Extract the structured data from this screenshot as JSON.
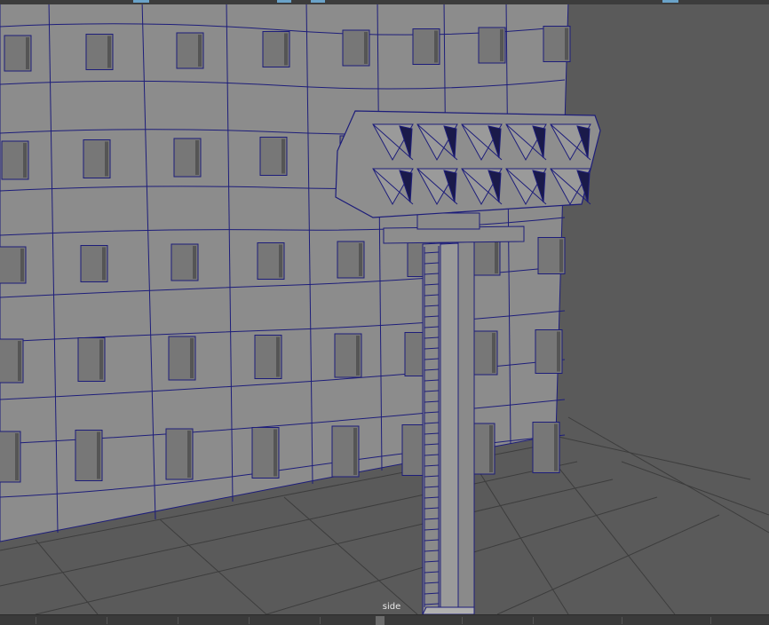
{
  "viewport": {
    "camera_label": "side"
  },
  "colors": {
    "background": "#5a5a5a",
    "wireframe": "#1d1d7a",
    "building_face": "#8c8c8c",
    "window_recess": "#6a6a6a",
    "grid_line": "#3c3c3c",
    "accent": "#6aa3c9"
  },
  "icons": {
    "time_slider": "time-slider-icon"
  }
}
